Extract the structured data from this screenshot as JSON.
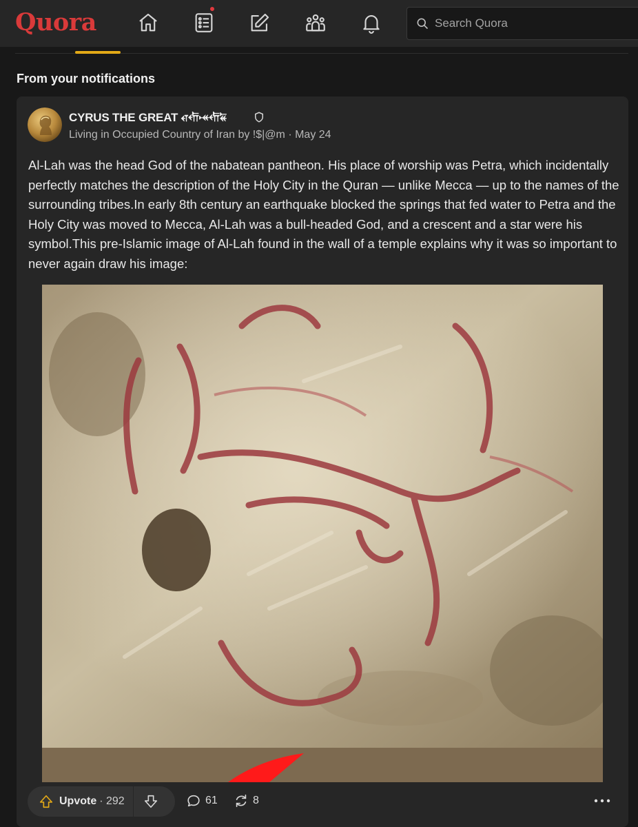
{
  "header": {
    "logo": "Quora",
    "nav": [
      {
        "name": "home-icon"
      },
      {
        "name": "following-icon",
        "has_dot": true
      },
      {
        "name": "answer-icon"
      },
      {
        "name": "spaces-icon"
      },
      {
        "name": "notifications-icon"
      }
    ],
    "search": {
      "placeholder": "Search Quora",
      "value": ""
    }
  },
  "section": {
    "title": "From your notifications"
  },
  "post": {
    "author": "CYRUS THE GREAT 𐎤𐎢𐎽𐎢𐏁",
    "credential": "Living in Occupied Country of Iran by !$|@m · May 24",
    "body": "Al-Lah was the head God of the nabatean pantheon. His place of worship was Petra, which incidentally perfectly matches the description of the Holy City in the Quran — unlike Mecca — up to the names of the surrounding tribes.In early 8th century an earthquake blocked the springs that fed water to Petra and the Holy City was moved to Mecca, Al-Lah was a bull-headed God, and a crescent and a star were his symbol.This pre-Islamic image of Al-Lah found in the wall of a temple explains why it was so important to never again draw his image:",
    "image_alt": "Red-painted bull head on a stone wall"
  },
  "actions": {
    "upvote_label": "Upvote",
    "upvote_count": "· 292",
    "comments": "61",
    "shares": "8"
  },
  "colors": {
    "brand": "#d93a3a",
    "upvote_accent": "#e3a917",
    "notification_dot": "#e0393e"
  }
}
